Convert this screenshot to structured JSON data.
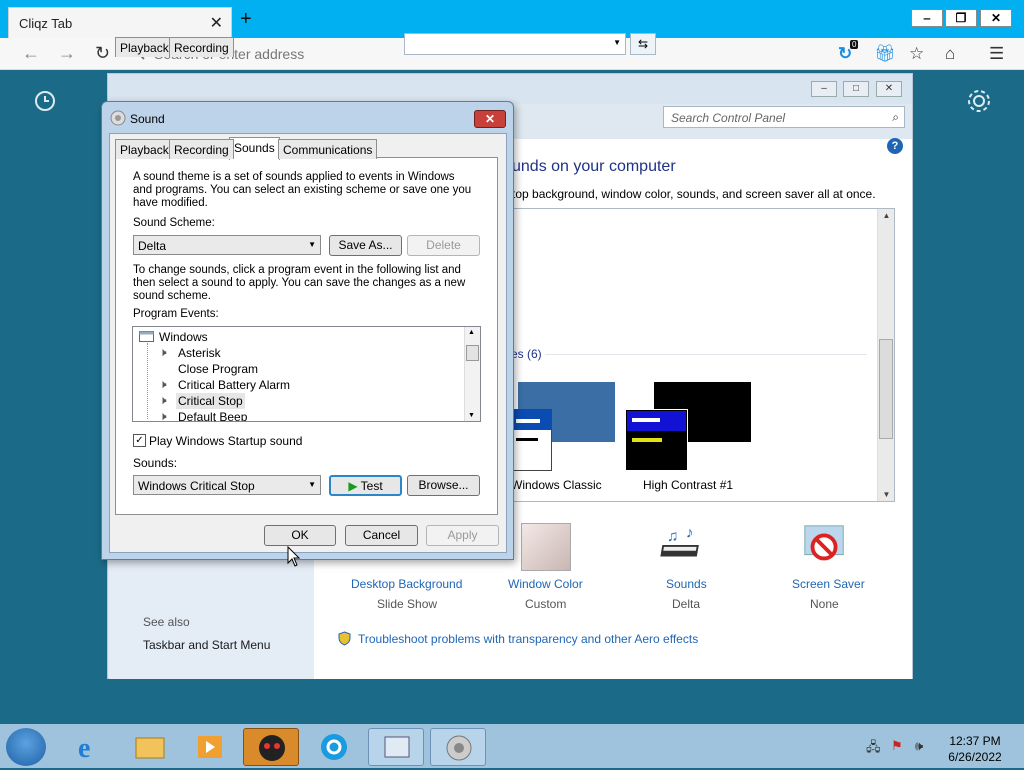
{
  "browser": {
    "tab_title": "Cliqz Tab",
    "tab_close": "✕",
    "new_tab": "+",
    "address_placeholder": "Search or enter address",
    "badge_count": "0",
    "window_buttons": [
      "‒",
      "❐",
      "✕"
    ]
  },
  "control_panel": {
    "search_placeholder": "Search Control Panel",
    "heading": "unds on your computer",
    "subheading": "top background, window color, sounds, and screen saver all at once.",
    "theme_group_label": "es (6)",
    "themes": [
      {
        "name": "Windows Classic"
      },
      {
        "name": "High Contrast #1"
      }
    ],
    "tiles": [
      {
        "label": "Desktop Background",
        "value": "Slide Show"
      },
      {
        "label": "Window Color",
        "value": "Custom"
      },
      {
        "label": "Sounds",
        "value": "Delta"
      },
      {
        "label": "Screen Saver",
        "value": "None"
      }
    ],
    "troubleshoot_link": "Troubleshoot problems with transparency and other Aero effects",
    "see_also": "See also",
    "taskbar_link": "Taskbar and Start Menu"
  },
  "sound_dialog": {
    "title": "Sound",
    "close": "✕",
    "tabs": [
      "Playback",
      "Recording",
      "Sounds",
      "Communications"
    ],
    "active_tab": "Sounds",
    "intro": [
      "A sound theme is a set of sounds applied to events in Windows",
      "and programs.  You can select an existing scheme or save one you",
      "have modified."
    ],
    "scheme_label": "Sound Scheme:",
    "scheme_value": "Delta",
    "save_as": "Save As...",
    "delete": "Delete",
    "instructions": [
      "To change sounds, click a program event in the following list and",
      "then select a sound to apply.  You can save the changes as a new",
      "sound scheme."
    ],
    "events_label": "Program Events:",
    "events": [
      {
        "label": "Windows",
        "level": 0,
        "icon": "window",
        "selected": false
      },
      {
        "label": "Asterisk",
        "level": 1,
        "icon": "speaker",
        "selected": false
      },
      {
        "label": "Close Program",
        "level": 1,
        "icon": "none",
        "selected": false
      },
      {
        "label": "Critical Battery Alarm",
        "level": 1,
        "icon": "speaker",
        "selected": false
      },
      {
        "label": "Critical Stop",
        "level": 1,
        "icon": "speaker",
        "selected": true
      },
      {
        "label": "Default Beep",
        "level": 1,
        "icon": "speaker",
        "selected": false
      }
    ],
    "startup_checkbox": "Play Windows Startup sound",
    "startup_checked": true,
    "sounds_label": "Sounds:",
    "sound_value": "Windows Critical Stop",
    "test": "Test",
    "browse": "Browse...",
    "ok": "OK",
    "cancel": "Cancel",
    "apply": "Apply"
  },
  "taskbar": {
    "time": "12:37 PM",
    "date": "6/26/2022"
  }
}
